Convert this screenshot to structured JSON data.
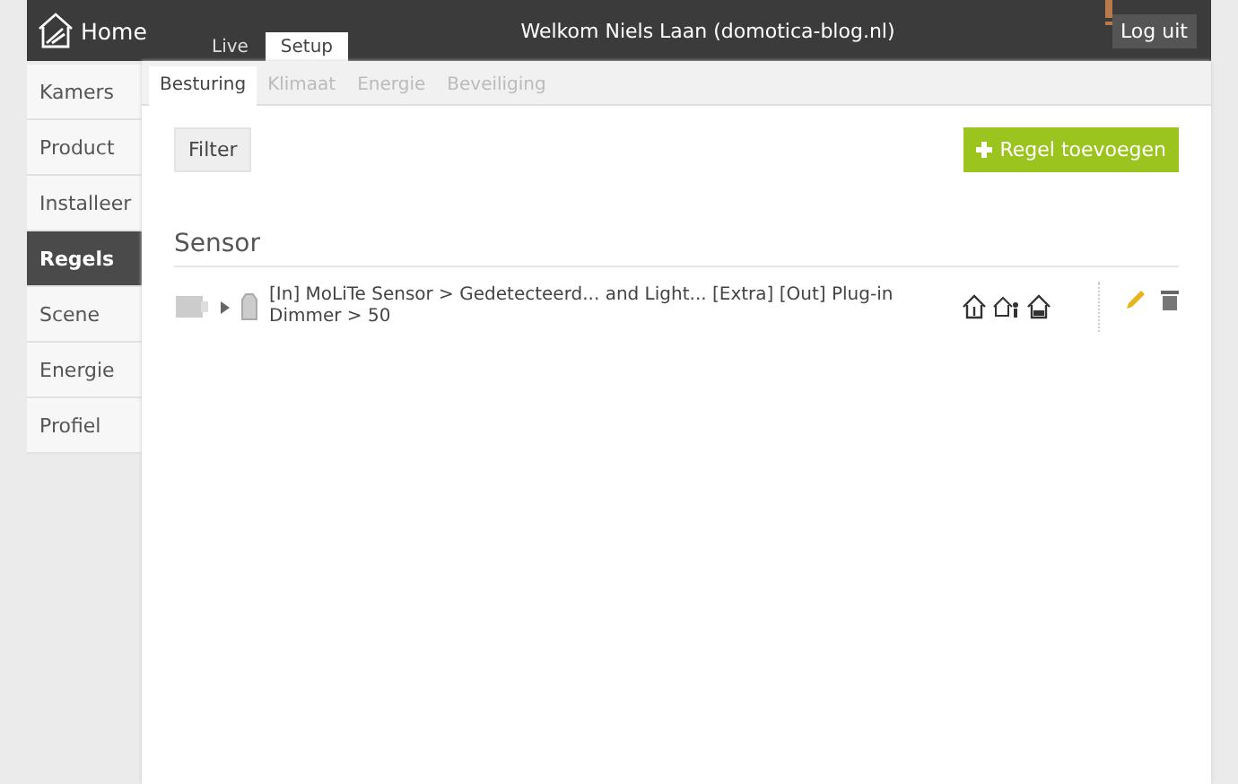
{
  "header": {
    "home": "Home",
    "nav_tabs": [
      {
        "label": "Live",
        "selected": false
      },
      {
        "label": "Setup",
        "selected": true
      }
    ],
    "welcome": "Welkom Niels Laan (domotica-blog.nl)",
    "logout": "Log uit"
  },
  "sidebar": {
    "items": [
      {
        "label": "Kamers",
        "selected": false
      },
      {
        "label": "Product",
        "selected": false
      },
      {
        "label": "Installeer",
        "selected": false
      },
      {
        "label": "Regels",
        "selected": true
      },
      {
        "label": "Scene",
        "selected": false
      },
      {
        "label": "Energie",
        "selected": false
      },
      {
        "label": "Profiel",
        "selected": false
      }
    ]
  },
  "sub_tabs": [
    {
      "label": "Besturing",
      "selected": true
    },
    {
      "label": "Klimaat",
      "selected": false
    },
    {
      "label": "Energie",
      "selected": false
    },
    {
      "label": "Beveiliging",
      "selected": false
    }
  ],
  "toolbar": {
    "filter": "Filter",
    "add": "Regel toevoegen"
  },
  "section": {
    "title": "Sensor",
    "rules": [
      {
        "text": "[In] MoLiTe Sensor > Gedetecteerd... and Light... [Extra] [Out] Plug-in Dimmer > 50"
      }
    ]
  }
}
